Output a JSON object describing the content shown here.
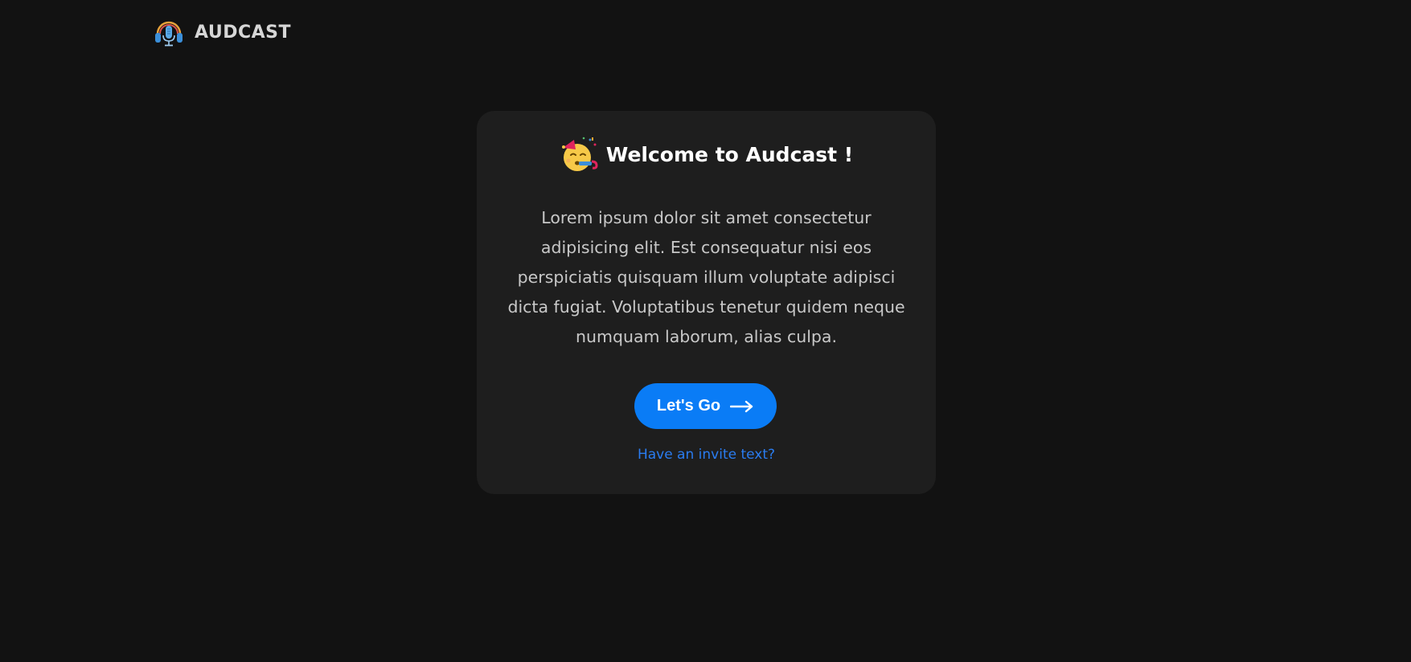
{
  "header": {
    "brand_name": "AUDCAST",
    "logo_icon": "podcast-headphones-microphone-icon"
  },
  "welcome_card": {
    "title_icon": "partying-face-icon",
    "title": "Welcome to Audcast !",
    "description": "Lorem ipsum dolor sit amet consectetur adipisicing elit. Est consequatur nisi eos perspiciatis quisquam illum voluptate adipisci dicta fugiat. Voluptatibus tenetur quidem neque numquam laborum, alias culpa.",
    "cta_label": "Let's Go",
    "cta_icon": "arrow-right-icon",
    "invite_link": "Have an invite text?"
  },
  "colors": {
    "background": "#121212",
    "card": "#1e1e1e",
    "accent": "#0a7cf6",
    "link": "#2a7cf0"
  }
}
